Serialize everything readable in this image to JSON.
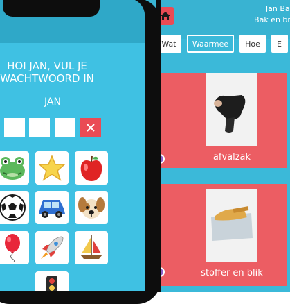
{
  "tablet": {
    "user_name": "Jan Bak",
    "user_subtitle": "Bak en bri",
    "tabs": [
      {
        "label": "Wat"
      },
      {
        "label": "Waarmee"
      },
      {
        "label": "Hoe"
      },
      {
        "label": "E"
      }
    ],
    "active_tab": "Waarmee",
    "cards": [
      {
        "label": "afvalzak"
      },
      {
        "label": "stoffer en blik"
      }
    ]
  },
  "phone": {
    "prompt": "HOI JAN, VUL JE WACHTWOORD IN",
    "username": "JAN",
    "pin_slots": [
      "",
      "",
      ""
    ],
    "emoji_grid": [
      {
        "icon": "frog-icon",
        "glyph": "🐸"
      },
      {
        "icon": "star-icon",
        "glyph": "⭐"
      },
      {
        "icon": "apple-icon",
        "glyph": "🍎"
      },
      {
        "icon": "soccer-ball-icon",
        "glyph": "⚽"
      },
      {
        "icon": "car-icon",
        "glyph": "🚙"
      },
      {
        "icon": "dog-icon",
        "glyph": "🐶"
      },
      {
        "icon": "balloon-icon",
        "glyph": "🎈"
      },
      {
        "icon": "rocket-icon",
        "glyph": "🚀"
      },
      {
        "icon": "sailboat-icon",
        "glyph": "⛵"
      },
      {
        "icon": "traffic-light-icon",
        "glyph": "🚦"
      }
    ]
  },
  "colors": {
    "phone_bg": "#3fc1e3",
    "tablet_bg": "#3bb9d9",
    "accent_red": "#ea4b55",
    "card_red": "#ec5d63"
  }
}
